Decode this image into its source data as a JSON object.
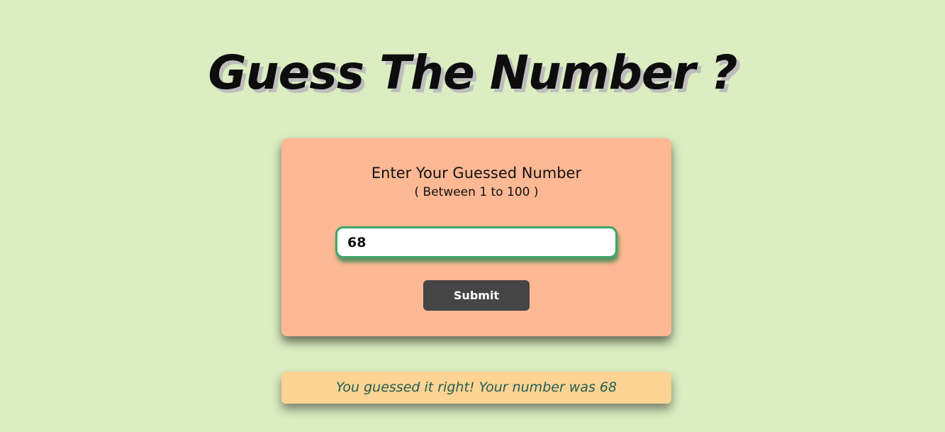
{
  "header": {
    "title": "Guess The Number ?"
  },
  "form": {
    "prompt": "Enter Your Guessed Number",
    "range_hint": "( Between 1 to 100 )",
    "input_value": "68",
    "submit_label": "Submit"
  },
  "result": {
    "message": "You guessed it right! Your number was 68"
  },
  "colors": {
    "background": "#dbedc1",
    "card": "#feb894",
    "input_border": "#3fa56a",
    "button": "#454545",
    "result_bg": "#fdd493",
    "result_text": "#255c55"
  }
}
